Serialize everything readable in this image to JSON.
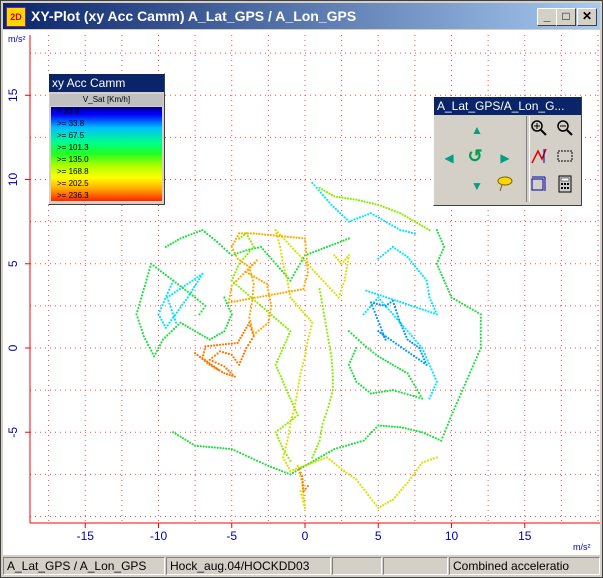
{
  "window": {
    "app_icon_label": "2D",
    "title": "XY-Plot (xy Acc Camm)   A_Lat_GPS / A_Lon_GPS",
    "minimize_label": "_",
    "maximize_label": "□",
    "close_label": "✕"
  },
  "plot": {
    "y_unit": "m/s²",
    "x_unit": "m/s²"
  },
  "legend": {
    "title": "xy Acc Camm",
    "unit_label": "V_Sat  [Km/h]",
    "rows": [
      "<    33.8",
      ">=   33.8",
      ">=   67.5",
      ">=  101.3",
      ">=  135.0",
      ">=  168.8",
      ">=  202.5",
      ">=  236.3"
    ]
  },
  "toolbox": {
    "title": "A_Lat_GPS/A_Lon_G...",
    "icons": [
      "arrow-up-icon",
      "zoom-in-icon",
      "zoom-out-icon",
      "arrow-left-icon",
      "reset-icon",
      "arrow-right-icon",
      "scale-y-icon",
      "select-rect-icon",
      "arrow-down-icon",
      "lasso-icon",
      "fit-icon",
      "calculator-icon"
    ]
  },
  "statusbar": {
    "channel": "A_Lat_GPS / A_Lon_GPS",
    "file": "Hock_aug.04/HOCKDD03",
    "cell3": "",
    "cell4": "",
    "mode": "Combined acceleratio"
  },
  "colors": {
    "title_bar_start": "#0a246a",
    "axis": "#ff0000",
    "tick_label": "#0000aa",
    "grid": "#ff4444"
  },
  "chart_data": {
    "type": "scatter",
    "title": "",
    "xlabel": "m/s²",
    "ylabel": "m/s²",
    "xlim": [
      -19.5,
      20
    ],
    "ylim": [
      -10.5,
      18.5
    ],
    "x_ticks": [
      -15,
      -10,
      -5,
      0,
      5,
      10,
      15
    ],
    "y_ticks": [
      -5,
      0,
      5,
      10,
      15
    ],
    "grid": true,
    "series": [
      {
        "color": "#00e5ff",
        "points": [
          [
            -9,
            4
          ],
          [
            -10,
            2
          ],
          [
            -9.5,
            1.2
          ],
          [
            -8,
            3
          ],
          [
            -7,
            4.4
          ],
          [
            -9.4,
            3
          ],
          [
            -8.8,
            1.5
          ],
          [
            4,
            2
          ],
          [
            5,
            3
          ],
          [
            6,
            2
          ],
          [
            7,
            1
          ],
          [
            8,
            0
          ],
          [
            9,
            -2
          ],
          [
            8.5,
            -3
          ],
          [
            5,
            5.3
          ],
          [
            6,
            6
          ],
          [
            7,
            5.4
          ],
          [
            8.3,
            4
          ],
          [
            8.5,
            3
          ],
          [
            9,
            2
          ],
          [
            4.2,
            3.4
          ],
          [
            0.5,
            9.8
          ],
          [
            1.8,
            8.5
          ],
          [
            3,
            7.5
          ],
          [
            4.5,
            8
          ],
          [
            6.5,
            7
          ],
          [
            7.5,
            6.8
          ]
        ]
      },
      {
        "color": "#009dff",
        "points": [
          [
            4.5,
            2.7
          ],
          [
            5.5,
            2.5
          ],
          [
            6,
            2.8
          ],
          [
            6.5,
            1.5
          ],
          [
            7,
            0.5
          ],
          [
            7.8,
            0
          ],
          [
            8.3,
            -1
          ],
          [
            5,
            1
          ],
          [
            5.3,
            0.8
          ],
          [
            5.5,
            0.5
          ]
        ]
      },
      {
        "color": "#22dd44",
        "points": [
          [
            -9,
            -5
          ],
          [
            -7.5,
            -5.8
          ],
          [
            -5,
            -6
          ],
          [
            -2.5,
            -7
          ],
          [
            -1,
            -7.5
          ],
          [
            2,
            -6
          ],
          [
            4,
            -5.5
          ],
          [
            5,
            -4.6
          ],
          [
            6.5,
            -4.7
          ],
          [
            8,
            -5
          ],
          [
            9.3,
            -5.5
          ],
          [
            10,
            -4
          ],
          [
            11,
            -2
          ],
          [
            12,
            0
          ],
          [
            12,
            2
          ],
          [
            10,
            3
          ],
          [
            9.5,
            4
          ],
          [
            9,
            5
          ],
          [
            9.5,
            6
          ],
          [
            9,
            7
          ],
          [
            -9.5,
            6
          ],
          [
            -8.5,
            6.5
          ],
          [
            -7,
            7
          ],
          [
            -6,
            6.3
          ],
          [
            -5,
            5.5
          ],
          [
            -4,
            5.8
          ],
          [
            -3,
            6
          ],
          [
            -2,
            5
          ],
          [
            -1,
            4
          ],
          [
            0,
            5.5
          ],
          [
            1.5,
            6
          ],
          [
            3,
            6.5
          ],
          [
            -5.5,
            3
          ],
          [
            -5,
            2
          ],
          [
            -5.5,
            1
          ],
          [
            -6.5,
            0.5
          ],
          [
            -7.5,
            1
          ],
          [
            -8.5,
            1.5
          ],
          [
            -9.7,
            0.5
          ],
          [
            -10.3,
            -0.5
          ],
          [
            -11,
            0.7
          ],
          [
            -11.5,
            2
          ],
          [
            -11,
            3.5
          ],
          [
            -10.5,
            5
          ],
          [
            -7.5,
            3
          ],
          [
            -6.8,
            2.5
          ],
          [
            -7.2,
            2
          ],
          [
            3,
            1
          ],
          [
            4,
            0.2
          ],
          [
            5,
            -0.5
          ],
          [
            6,
            -1
          ],
          [
            7,
            -1.5
          ],
          [
            8,
            -3
          ],
          [
            6,
            -2.5
          ],
          [
            4.5,
            -2.7
          ],
          [
            3.5,
            -2
          ],
          [
            3,
            -1
          ],
          [
            3.5,
            0
          ]
        ]
      },
      {
        "color": "#88ee00",
        "points": [
          [
            -4.5,
            6.5
          ],
          [
            -4,
            6.8
          ],
          [
            -3.5,
            6
          ],
          [
            -4.5,
            5
          ],
          [
            -5,
            4
          ],
          [
            -1,
            1
          ],
          [
            -1.5,
            0
          ],
          [
            -2,
            -1
          ],
          [
            -1.5,
            -2
          ],
          [
            -1,
            -3
          ],
          [
            -0.5,
            -4
          ],
          [
            -2,
            -5
          ],
          [
            -1.5,
            -6
          ],
          [
            -1,
            -6.7
          ],
          [
            1,
            3.5
          ],
          [
            1.2,
            2.5
          ],
          [
            1.4,
            1.5
          ],
          [
            1.6,
            0.5
          ],
          [
            1.8,
            -0.5
          ],
          [
            1.9,
            -1.5
          ],
          [
            1.9,
            -2.5
          ],
          [
            1.6,
            -3.5
          ],
          [
            1.2,
            -4.5
          ],
          [
            1,
            -5.5
          ],
          [
            0.5,
            -6.5
          ],
          [
            1,
            9.5
          ],
          [
            2,
            9
          ],
          [
            3.5,
            8.8
          ],
          [
            5,
            8.5
          ],
          [
            6.5,
            8
          ],
          [
            7.5,
            7.5
          ],
          [
            8.5,
            7
          ]
        ]
      },
      {
        "color": "#dddd00",
        "points": [
          [
            -2,
            7
          ],
          [
            -1.7,
            6
          ],
          [
            -1.5,
            5
          ],
          [
            -1.2,
            4
          ],
          [
            -1,
            3
          ],
          [
            -0.5,
            2.5
          ],
          [
            0,
            2
          ],
          [
            0.5,
            1.5
          ],
          [
            0.2,
            0.5
          ],
          [
            0,
            -0.5
          ],
          [
            -0.3,
            -1.5
          ],
          [
            -0.5,
            -2.5
          ],
          [
            -0.7,
            -3.5
          ],
          [
            -1,
            -4.5
          ],
          [
            -1.2,
            -5.5
          ],
          [
            -1.5,
            -6.5
          ],
          [
            -1,
            -7.3
          ],
          [
            1.5,
            -6.5
          ],
          [
            2.5,
            -7.2
          ],
          [
            3.5,
            -7.8
          ],
          [
            5,
            -9.5
          ],
          [
            6,
            -9
          ],
          [
            7,
            -8
          ],
          [
            8,
            -6.8
          ],
          [
            9,
            -6.5
          ],
          [
            -0.3,
            -8.5
          ],
          [
            0,
            -9.5
          ],
          [
            -0.2,
            -8
          ],
          [
            -0.5,
            -7
          ],
          [
            2,
            5.5
          ],
          [
            2.5,
            5
          ],
          [
            3,
            5.5
          ],
          [
            2.7,
            4
          ],
          [
            2.3,
            3
          ]
        ]
      },
      {
        "color": "#ffaa00",
        "points": [
          [
            -3.5,
            6.8
          ],
          [
            -4.5,
            6.8
          ],
          [
            -5,
            6
          ],
          [
            -4.6,
            5.3
          ],
          [
            -3.8,
            4.8
          ],
          [
            -3.5,
            3.8
          ],
          [
            -3.6,
            2.8
          ],
          [
            -3.8,
            1.8
          ],
          [
            -3.5,
            0.8
          ],
          [
            -2.5,
            1.5
          ],
          [
            -2.3,
            2.5
          ],
          [
            -2.6,
            3.8
          ],
          [
            -4,
            4.5
          ],
          [
            -3.3,
            5.2
          ],
          [
            -5,
            3.7
          ],
          [
            -5.2,
            2.7
          ],
          [
            -0.1,
            3.5
          ],
          [
            0.2,
            4.5
          ],
          [
            0.1,
            5.5
          ],
          [
            0,
            6.5
          ]
        ]
      },
      {
        "color": "#ff7700",
        "points": [
          [
            -7.5,
            -0.3
          ],
          [
            -6.5,
            -1
          ],
          [
            -5.5,
            -1.5
          ],
          [
            -4.8,
            -1.7
          ],
          [
            -5.5,
            -1.1
          ],
          [
            -6.5,
            -0.7
          ],
          [
            -5.8,
            -0.2
          ],
          [
            -5,
            -0.4
          ],
          [
            -4.5,
            -1
          ],
          [
            -4,
            0
          ],
          [
            -3.5,
            0.7
          ],
          [
            -3.8,
            1.5
          ],
          [
            -4.2,
            0.9
          ],
          [
            -4.6,
            0.3
          ],
          [
            -6.8,
            0.1
          ],
          [
            -7,
            -0.6
          ],
          [
            -5.9,
            -1.3
          ],
          [
            -0.4,
            -7.2
          ],
          [
            -0.2,
            -7.6
          ],
          [
            -0.1,
            -8.5
          ],
          [
            0.2,
            -8.2
          ]
        ]
      }
    ]
  }
}
